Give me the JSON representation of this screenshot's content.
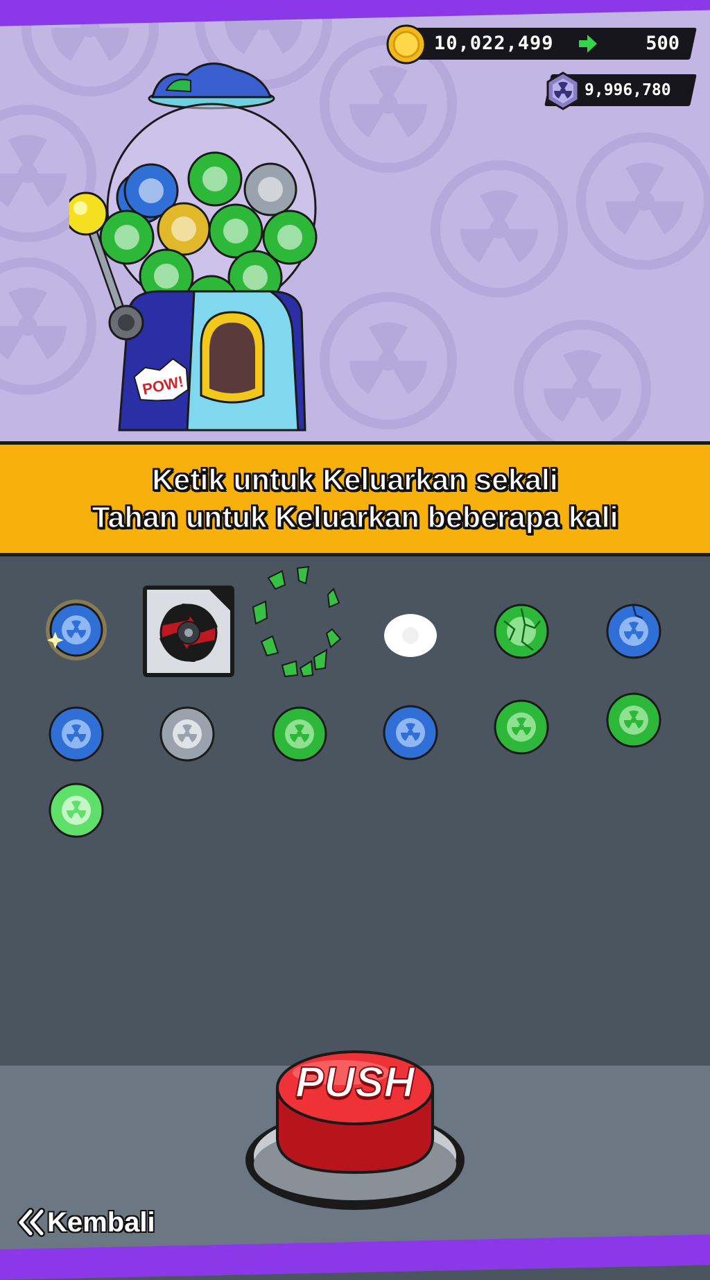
{
  "currency": {
    "coins": "10,022,499",
    "coins_gain": "500",
    "gems": "9,996,780",
    "coin_icon": "gold-coin-icon",
    "gem_icon": "radiation-gem-icon",
    "arrow_icon": "green-arrow-icon"
  },
  "instructions": {
    "line1": "Ketik untuk Keluarkan sekali",
    "line2": "Tahan untuk Keluarkan beberapa kali"
  },
  "prizes": [
    {
      "type": "capsule",
      "color": "blue",
      "state": "glowing"
    },
    {
      "type": "item-card",
      "item": "spinning-top",
      "color": "red"
    },
    {
      "type": "burst-fragments",
      "color": "green"
    },
    {
      "type": "capsule",
      "color": "white",
      "state": "flash"
    },
    {
      "type": "capsule",
      "color": "green",
      "state": "cracked"
    },
    {
      "type": "capsule",
      "color": "blue",
      "state": "cracked"
    },
    {
      "type": "capsule",
      "color": "blue",
      "state": "normal"
    },
    {
      "type": "capsule",
      "color": "silver",
      "state": "normal"
    },
    {
      "type": "capsule",
      "color": "green",
      "state": "normal"
    },
    {
      "type": "capsule",
      "color": "blue",
      "state": "normal"
    },
    {
      "type": "capsule",
      "color": "green",
      "state": "normal"
    },
    {
      "type": "capsule",
      "color": "green",
      "state": "normal"
    },
    {
      "type": "capsule",
      "color": "lightgreen",
      "state": "normal"
    }
  ],
  "push_button": {
    "label": "PUSH"
  },
  "back_button": {
    "label": "Kembali"
  },
  "machine_sticker": "POW!",
  "colors": {
    "banner": "#f8b10c",
    "top_bg": "#c2b6e4",
    "bottom_bg": "#4a5560",
    "stripe": "#8a38e8",
    "capsule_blue": "#2f6fd6",
    "capsule_green": "#2db83a",
    "capsule_silver": "#9aa2ad",
    "capsule_gold": "#e0b82a"
  }
}
